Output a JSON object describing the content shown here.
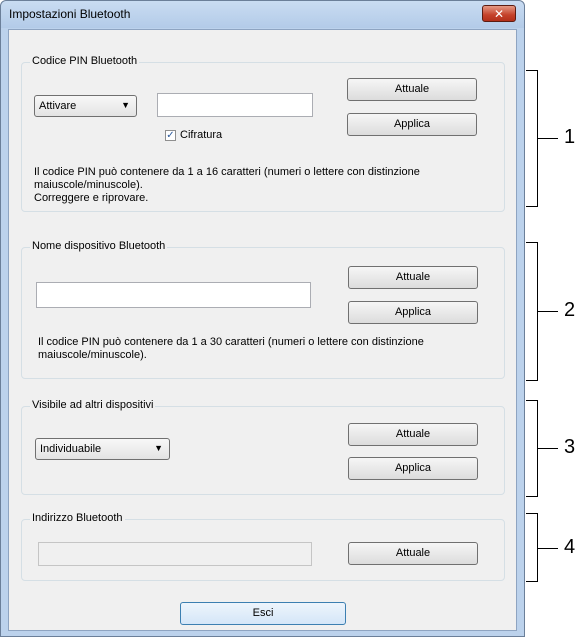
{
  "window": {
    "title": "Impostazioni Bluetooth",
    "close_label": "✕"
  },
  "pin_group": {
    "title": "Codice PIN Bluetooth",
    "select_value": "Attivare",
    "pin_value": "",
    "attuale_label": "Attuale",
    "applica_label": "Applica",
    "checkbox_label": "Cifratura",
    "checkbox_checked": true,
    "help_line1": "Il codice PIN può contenere da 1 a 16 caratteri (numeri o lettere con distinzione",
    "help_line2": "maiuscole/minuscole).",
    "help_line3": "Correggere e riprovare."
  },
  "name_group": {
    "title": "Nome dispositivo Bluetooth",
    "name_value": "",
    "attuale_label": "Attuale",
    "applica_label": "Applica",
    "help_line1": "Il codice PIN può contenere da 1 a 30 caratteri (numeri o lettere con distinzione",
    "help_line2": "maiuscole/minuscole)."
  },
  "visible_group": {
    "title": "Visibile ad altri dispositivi",
    "select_value": "Individuabile",
    "attuale_label": "Attuale",
    "applica_label": "Applica"
  },
  "address_group": {
    "title": "Indirizzo Bluetooth",
    "address_value": "",
    "attuale_label": "Attuale"
  },
  "footer": {
    "exit_label": "Esci"
  },
  "callouts": {
    "one": "1",
    "two": "2",
    "three": "3",
    "four": "4"
  },
  "icons": {
    "dropdown": "chevron-down-icon",
    "check": "checkmark-icon",
    "close": "close-icon"
  }
}
